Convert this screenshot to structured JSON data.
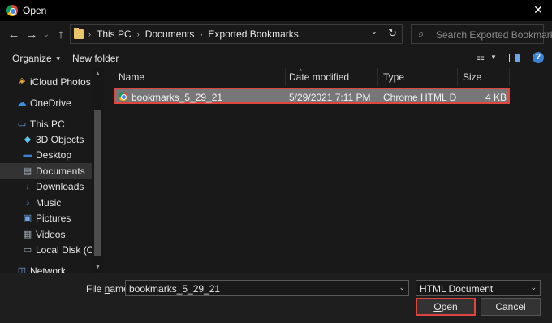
{
  "window": {
    "title": "Open",
    "close_glyph": "✕"
  },
  "nav": {
    "back_glyph": "←",
    "forward_glyph": "→",
    "recent_glyph": "⌄",
    "up_glyph": "↑",
    "breadcrumb": [
      "This PC",
      "Documents",
      "Exported Bookmarks"
    ],
    "breadcrumb_sep": "›",
    "dropdown_glyph": "⌄",
    "refresh_glyph": "↻",
    "search_placeholder": "Search Exported Bookmarks"
  },
  "toolbar": {
    "organize": "Organize",
    "new_folder": "New folder"
  },
  "sidebar": {
    "items": [
      {
        "label": "iCloud Photos",
        "icon": "icloud-photos-icon",
        "color": "#e8a33d"
      },
      {
        "label": "OneDrive",
        "icon": "onedrive-cloud-icon",
        "color": "#3a8ee6"
      },
      {
        "label": "This PC",
        "icon": "computer-icon",
        "color": "#6fa7e6"
      },
      {
        "label": "3D Objects",
        "icon": "cube-icon",
        "color": "#5ac8f0"
      },
      {
        "label": "Desktop",
        "icon": "desktop-icon",
        "color": "#3b82d6"
      },
      {
        "label": "Documents",
        "icon": "documents-icon",
        "color": "#9aa7b5"
      },
      {
        "label": "Downloads",
        "icon": "download-arrow-icon",
        "color": "#3a8ee6"
      },
      {
        "label": "Music",
        "icon": "music-note-icon",
        "color": "#3a8ee6"
      },
      {
        "label": "Pictures",
        "icon": "pictures-icon",
        "color": "#6fa7e6"
      },
      {
        "label": "Videos",
        "icon": "film-icon",
        "color": "#9aa7b5"
      },
      {
        "label": "Local Disk (C:)",
        "icon": "disk-drive-icon",
        "color": "#9aa7b5"
      },
      {
        "label": "Network",
        "icon": "network-icon",
        "color": "#6fa7e6"
      }
    ],
    "selected": "Documents"
  },
  "file_list": {
    "columns": [
      "Name",
      "Date modified",
      "Type",
      "Size"
    ],
    "rows": [
      {
        "name": "bookmarks_5_29_21",
        "date": "5/29/2021 7:11 PM",
        "type": "Chrome HTML Do...",
        "size": "4 KB"
      }
    ]
  },
  "footer": {
    "file_name_label_prefix": "File ",
    "file_name_label_key": "n",
    "file_name_label_suffix": "ame:",
    "file_name_value": "bookmarks_5_29_21",
    "file_type": "HTML Document",
    "open_key": "O",
    "open_rest": "pen",
    "cancel": "Cancel"
  },
  "colors": {
    "highlight_border": "#e0463f",
    "selected_row": "#777777"
  }
}
